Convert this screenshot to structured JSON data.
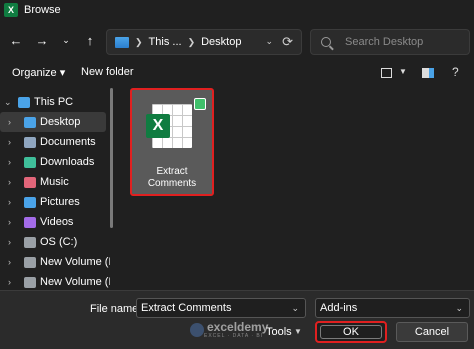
{
  "window": {
    "title": "Browse",
    "app_icon_letter": "X"
  },
  "nav": {
    "back_icon": "arrow-left-icon",
    "forward_icon": "arrow-right-icon",
    "recent_icon": "chevron-down-icon",
    "up_icon": "arrow-up-icon"
  },
  "address": {
    "segments": [
      "This ...",
      "Desktop"
    ]
  },
  "search": {
    "placeholder": "Search Desktop"
  },
  "toolbar": {
    "organize_label": "Organize ▾",
    "new_folder_label": "New folder"
  },
  "sidebar": {
    "items": [
      {
        "label": "This PC",
        "icon": "monitor-icon",
        "color": "#4aa3e8"
      },
      {
        "label": "Desktop",
        "icon": "desktop-folder-icon",
        "color": "#4aa3e8",
        "selected": true
      },
      {
        "label": "Documents",
        "icon": "documents-icon",
        "color": "#8fa6c0"
      },
      {
        "label": "Downloads",
        "icon": "downloads-icon",
        "color": "#3fbf9a"
      },
      {
        "label": "Music",
        "icon": "music-icon",
        "color": "#e2667a"
      },
      {
        "label": "Pictures",
        "icon": "pictures-icon",
        "color": "#4aa3e8"
      },
      {
        "label": "Videos",
        "icon": "videos-icon",
        "color": "#a36be8"
      },
      {
        "label": "OS (C:)",
        "icon": "drive-icon",
        "color": "#9aa0a6"
      },
      {
        "label": "New Volume (D",
        "icon": "drive-icon",
        "color": "#9aa0a6"
      },
      {
        "label": "New Volume (E",
        "icon": "drive-icon",
        "color": "#9aa0a6"
      }
    ]
  },
  "content": {
    "files": [
      {
        "name": "Extract Comments",
        "selected": true
      }
    ]
  },
  "footer": {
    "file_name_label": "File name:",
    "file_name_value": "Extract Comments",
    "file_type_value": "Add-ins",
    "tools_label": "Tools",
    "ok_label": "OK",
    "cancel_label": "Cancel",
    "watermark_brand": "exceldemy",
    "watermark_tagline": "EXCEL · DATA · BI"
  },
  "colors": {
    "highlight_border": "#e02020",
    "excel_green": "#107c41",
    "background": "#202020"
  }
}
